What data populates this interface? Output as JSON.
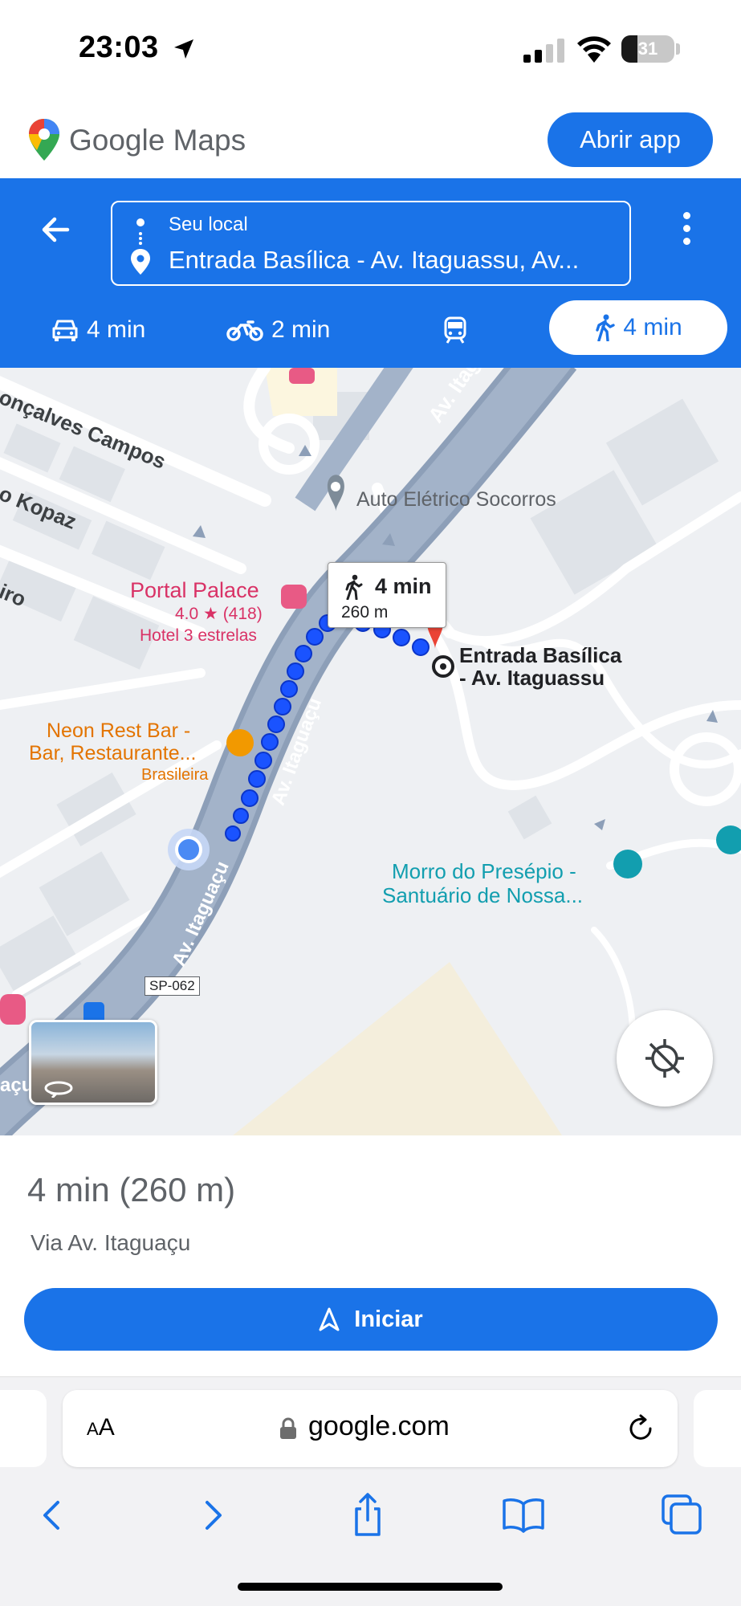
{
  "status_bar": {
    "time": "23:03",
    "battery": "31",
    "battery_level": 0.31
  },
  "header": {
    "brand": "Google Maps",
    "open_app": "Abrir app"
  },
  "directions": {
    "origin": "Seu local",
    "destination": "Entrada Basílica - Av. Itaguassu, Av...",
    "modes": {
      "car": "4 min",
      "motorcycle": "2 min",
      "transit": "",
      "walk": "4 min"
    }
  },
  "map": {
    "labels": {
      "goncalves": "onçalves Campos",
      "kopaz": "o Kopaz",
      "iro": "iro",
      "av_itagu_top": "Av. Itagu",
      "auto_eletrico": "Auto Elétrico Socorros",
      "portal_palace": "Portal Palace",
      "portal_rating": "4.0 ★ (418)",
      "portal_type": "Hotel 3 estrelas",
      "neon_line1": "Neon Rest Bar -",
      "neon_line2": "Bar, Restaurante...",
      "neon_type": "Brasileira",
      "av_itaguacu_route": "Av. Itaguaçu",
      "av_itaguacu_lower": "Av. Itaguaçu",
      "dest_line1": "Entrada Basílica",
      "dest_line2": "- Av. Itaguassu",
      "morro_line1": "Morro do Presépio -",
      "morro_line2": "Santuário de Nossa...",
      "sp_badge": "SP-062",
      "acu": "açu"
    },
    "callout": {
      "time": "4 min",
      "distance": "260 m"
    }
  },
  "sheet": {
    "summary": "4 min (260 m)",
    "via": "Via Av. Itaguaçu",
    "start": "Iniciar"
  },
  "browser": {
    "aa_small": "A",
    "aa_large": "A",
    "url": "google.com"
  },
  "colors": {
    "accent": "#1a73e8",
    "route": "#1a53ff",
    "destination_pin": "#ea4335"
  }
}
